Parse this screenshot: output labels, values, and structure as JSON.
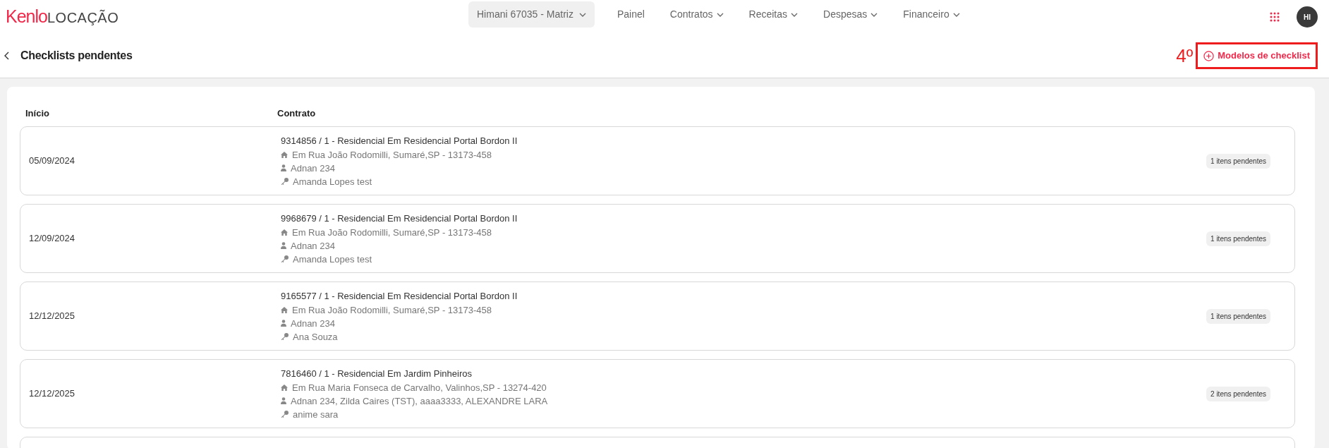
{
  "header": {
    "logo_brand": "Kenlo",
    "logo_product": "LOCAÇÃO",
    "account": "Himani 67035 - Matriz",
    "nav": [
      {
        "label": "Painel",
        "dropdown": false
      },
      {
        "label": "Contratos",
        "dropdown": true
      },
      {
        "label": "Receitas",
        "dropdown": true
      },
      {
        "label": "Despesas",
        "dropdown": true
      },
      {
        "label": "Financeiro",
        "dropdown": true
      }
    ],
    "avatar": "HI"
  },
  "page": {
    "title": "Checklists pendentes",
    "annotation": "4º",
    "action": "Modelos de checklist"
  },
  "table": {
    "columns": [
      "Início",
      "Contrato"
    ],
    "rows": [
      {
        "date": "05/09/2024",
        "contract": "9314856 / 1 - Residencial Em Residencial Portal Bordon II",
        "address": "Em Rua João Rodomilli, Sumaré,SP - 13173-458",
        "tenants": "Adnan 234",
        "owner": "Amanda Lopes test",
        "pending": "1 itens pendentes"
      },
      {
        "date": "12/09/2024",
        "contract": "9968679 / 1 - Residencial Em Residencial Portal Bordon II",
        "address": "Em Rua João Rodomilli, Sumaré,SP - 13173-458",
        "tenants": "Adnan 234",
        "owner": "Amanda Lopes test",
        "pending": "1 itens pendentes"
      },
      {
        "date": "12/12/2025",
        "contract": "9165577 / 1 - Residencial Em Residencial Portal Bordon II",
        "address": "Em Rua João Rodomilli, Sumaré,SP - 13173-458",
        "tenants": "Adnan 234",
        "owner": "Ana Souza",
        "pending": "1 itens pendentes"
      },
      {
        "date": "12/12/2025",
        "contract": "7816460 / 1 - Residencial Em Jardim Pinheiros",
        "address": "Em Rua Maria Fonseca de Carvalho, Valinhos,SP - 13274-420",
        "tenants": "Adnan 234, Zilda Caires (TST), aaaa3333, ALEXANDRE LARA",
        "owner": "anime sara",
        "pending": "2 itens pendentes"
      }
    ]
  }
}
